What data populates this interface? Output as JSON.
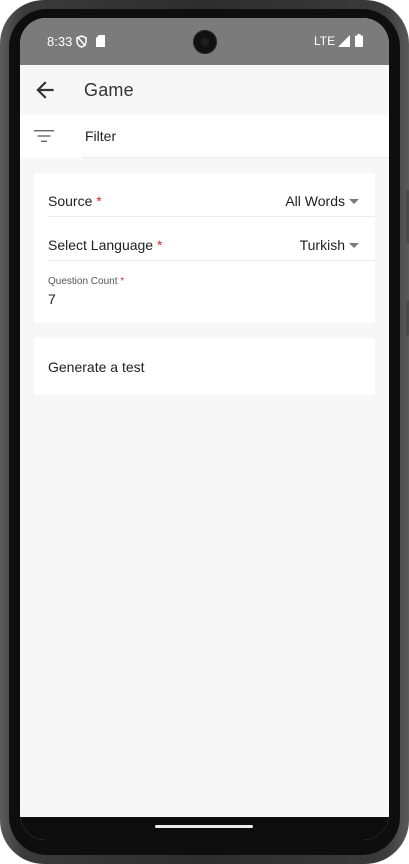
{
  "status_bar": {
    "time": "8:33",
    "network": "LTE",
    "icons": [
      "vpn-shield-icon",
      "sd-card-icon",
      "signal-icon",
      "battery-icon"
    ]
  },
  "app_bar": {
    "title": "Game",
    "back_icon": "arrow-back-icon"
  },
  "filter": {
    "label": "Filter",
    "icon": "filter-list-icon"
  },
  "form": {
    "source": {
      "label": "Source",
      "required_mark": "*",
      "value": "All Words"
    },
    "language": {
      "label": "Select Language",
      "required_mark": "*",
      "value": "Turkish"
    },
    "question_count": {
      "label": "Question Count",
      "required_mark": "*",
      "value": "7"
    }
  },
  "actions": {
    "generate_label": "Generate a test"
  },
  "colors": {
    "status_bar": "#7b7b7b",
    "background": "#f7f7f7",
    "card": "#ffffff",
    "required": "#d32f2f"
  }
}
